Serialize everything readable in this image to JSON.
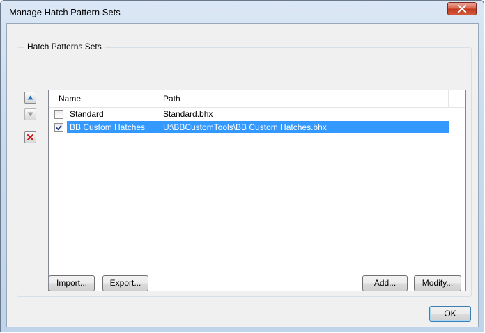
{
  "window": {
    "title": "Manage Hatch Pattern Sets"
  },
  "group": {
    "label": "Hatch Patterns Sets"
  },
  "table": {
    "columns": [
      "Name",
      "Path"
    ],
    "rows": [
      {
        "name": "Standard",
        "path": "Standard.bhx",
        "checked": false,
        "selected": false
      },
      {
        "name": "BB Custom Hatches",
        "path": "U:\\BBCustomTools\\BB Custom Hatches.bhx",
        "checked": true,
        "selected": true
      }
    ]
  },
  "buttons": {
    "import": "Import...",
    "export": "Export...",
    "add": "Add...",
    "modify": "Modify...",
    "ok": "OK"
  },
  "side_buttons": [
    {
      "icon": "move-up-icon",
      "enabled": true
    },
    {
      "icon": "move-down-icon",
      "enabled": false
    },
    {
      "icon": "delete-icon",
      "enabled": true
    }
  ],
  "colors": {
    "selection": "#3399ff",
    "close": "#c7402a"
  }
}
